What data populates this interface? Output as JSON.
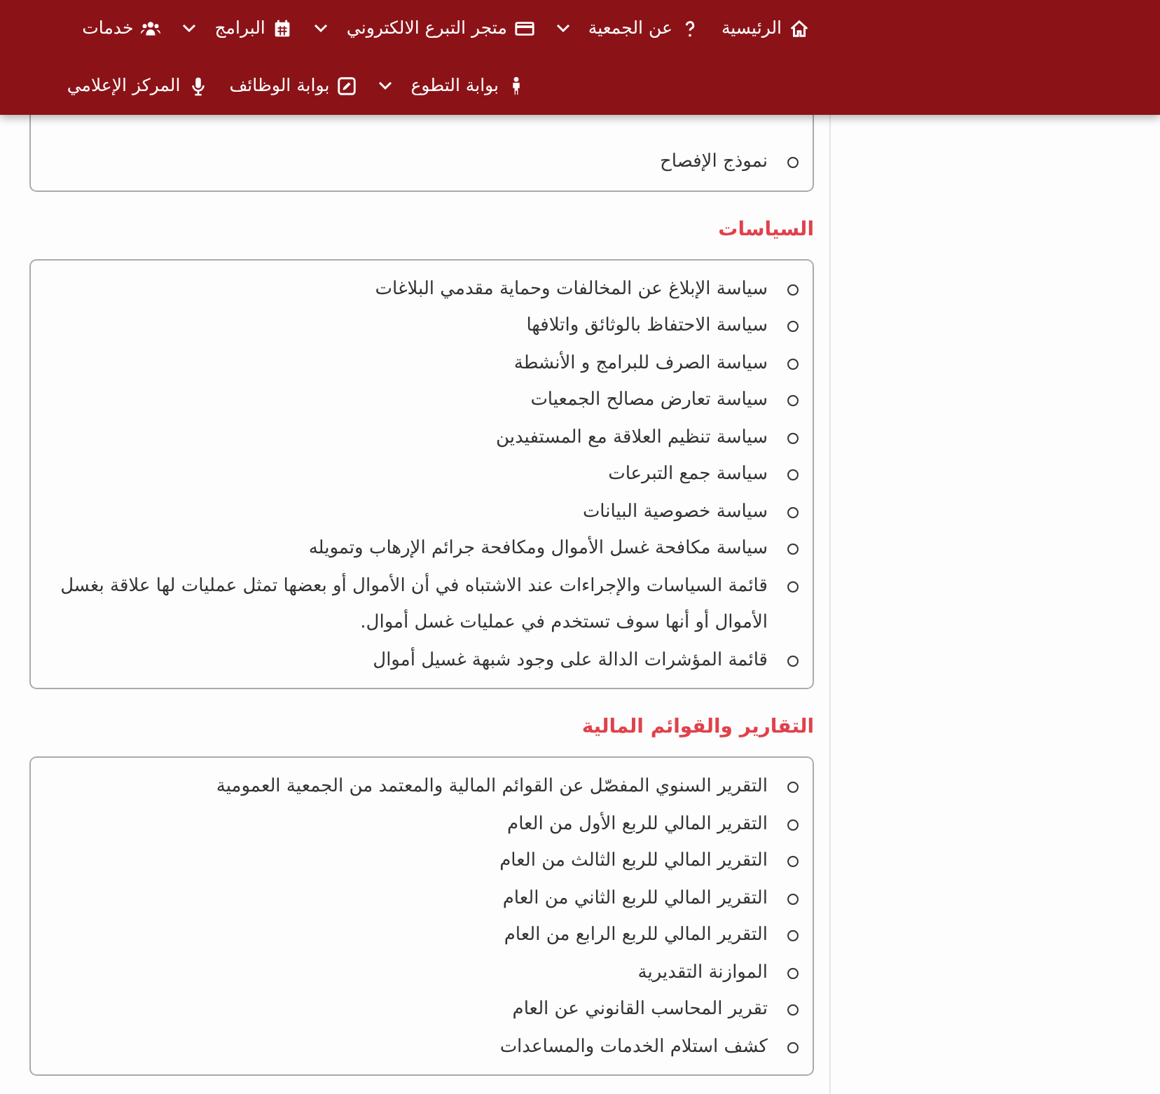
{
  "nav_rows": [
    [
      {
        "label": "الرئيسية",
        "dropdown": false
      },
      {
        "label": "عن الجمعية",
        "dropdown": true
      },
      {
        "label": "متجر التبرع الالكتروني",
        "dropdown": true
      },
      {
        "label": "البرامج",
        "dropdown": true
      },
      {
        "label": "خدمات",
        "dropdown": false
      }
    ],
    [
      {
        "label": "بوابة التطوع",
        "dropdown": true
      },
      {
        "label": "بوابة الوظائف",
        "dropdown": false
      },
      {
        "label": "المركز الإعلامي",
        "dropdown": false
      }
    ]
  ],
  "sections": [
    {
      "items": [
        "نموذج الإفصاح"
      ]
    },
    {
      "heading": "السياسات",
      "items": [
        "سياسة الإبلاغ عن المخالفات وحماية مقدمي البلاغات",
        "سياسة الاحتفاظ بالوثائق واتلافها",
        "سياسة الصرف للبرامج و الأنشطة",
        "سياسة تعارض مصالح الجمعيات",
        "سياسة تنظيم العلاقة مع المستفيدين",
        "سياسة جمع التبرعات",
        "سياسة خصوصية البيانات",
        "سياسة مكافحة غسل الأموال ومكافحة جرائم الإرهاب وتمويله",
        "قائمة السياسات والإجراءات عند الاشتباه في أن الأموال أو بعضها تمثل عمليات لها علاقة بغسل الأموال أو أنها سوف تستخدم في عمليات غسل أموال.",
        "قائمة المؤشرات الدالة على وجود شبهة غسيل أموال"
      ]
    },
    {
      "heading": "التقارير والقوائم المالية",
      "items": [
        "التقرير السنوي المفصّل عن القوائم المالية والمعتمد من الجمعية العمومية",
        "التقرير المالي للربع الأول من العام",
        "التقرير المالي للربع الثالث من العام",
        "التقرير المالي للربع الثاني من العام",
        "التقرير المالي للربع الرابع من العام",
        "الموازنة التقديرية",
        "تقرير المحاسب القانوني عن العام",
        "كشف استلام الخدمات والمساعدات"
      ]
    }
  ]
}
